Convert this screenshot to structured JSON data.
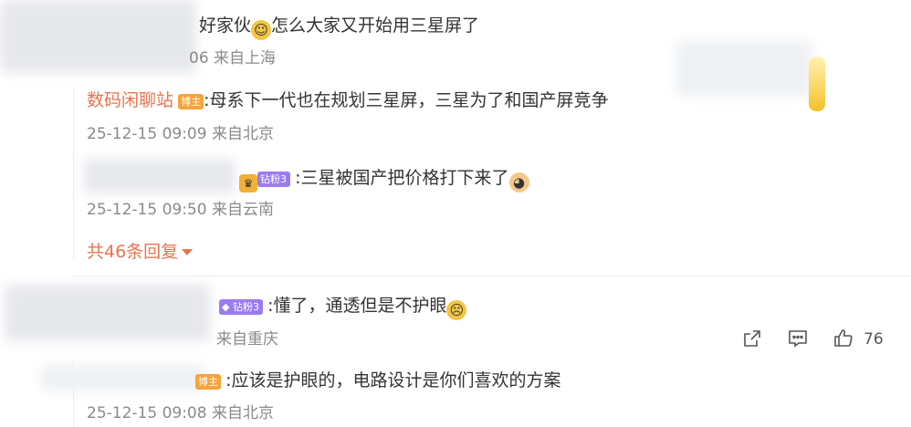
{
  "comment1": {
    "text_prefix": "好家伙",
    "emoji": "smile-icon",
    "text_suffix": "怎么大家又开始用三星屏了",
    "meta_time_fragment": "06",
    "location": "来自上海"
  },
  "reply1": {
    "username": "数码闲聊站",
    "badge": "博主",
    "text": ":母系下一代也在规划三星屏，三星为了和国产屏竞争",
    "timestamp": "25-12-15 09:09",
    "location": "来自北京"
  },
  "reply2": {
    "badge": "钻粉3",
    "text": ":三星被国产把价格打下来了",
    "emoji": "doge-icon",
    "timestamp": "25-12-15 09:50",
    "location": "来自云南"
  },
  "more_replies": {
    "label": "共46条回复"
  },
  "comment2": {
    "badge": "钻粉3",
    "text": ":懂了，通透但是不护眼",
    "emoji": "crying-icon",
    "location": "来自重庆",
    "actions": {
      "share_icon": "share-icon",
      "comment_icon": "comment-icon",
      "like_icon": "like-icon",
      "like_count": "76"
    }
  },
  "reply3": {
    "badge": "博主",
    "text": ":应该是护眼的，电路设计是你们喜欢的方案",
    "timestamp": "25-12-15 09:08",
    "location": "来自北京"
  },
  "colors": {
    "username": "#eb7350",
    "meta": "#8a8a8a",
    "badge_blogger": "#f7a23b",
    "badge_fan": "#9b7cf0"
  }
}
